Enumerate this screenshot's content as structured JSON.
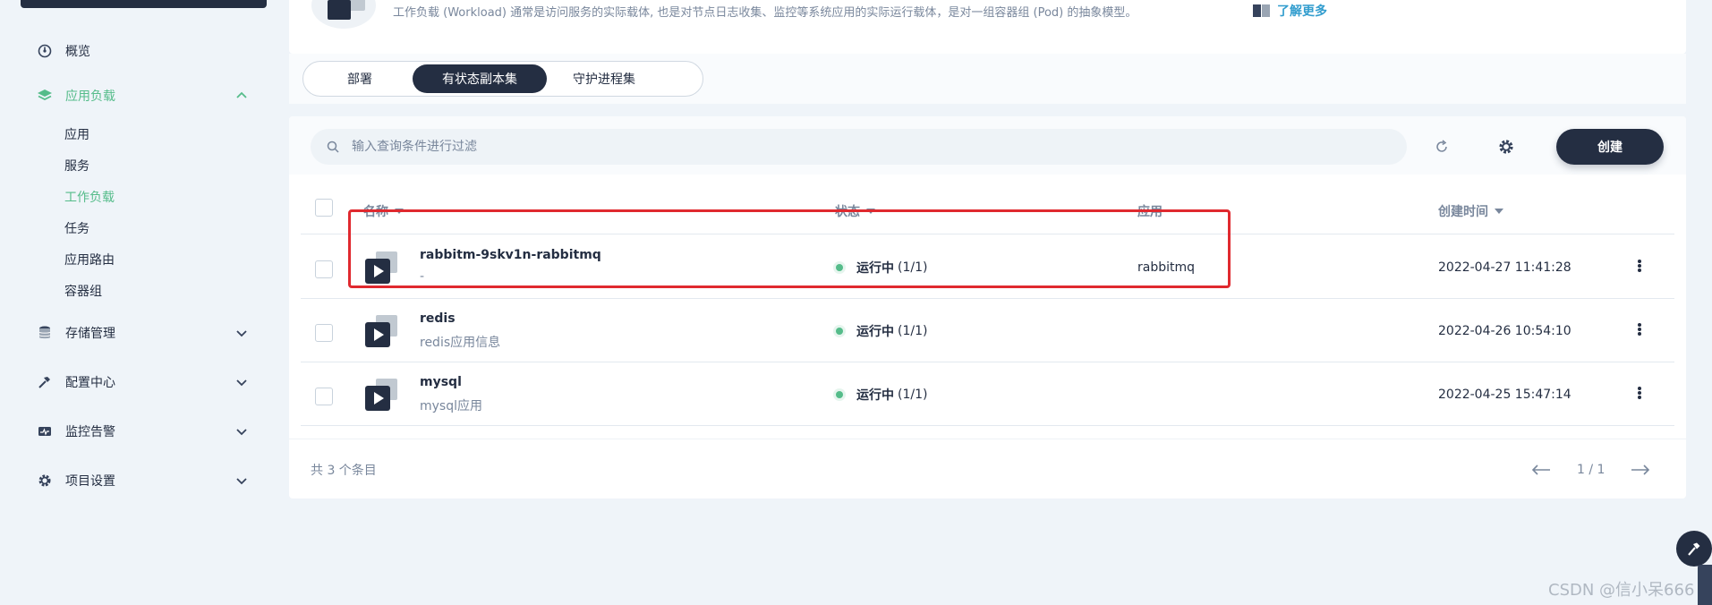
{
  "sidebar": {
    "items": [
      {
        "label": "概览",
        "icon": "dashboard-icon"
      },
      {
        "label": "应用负载",
        "icon": "layers-icon",
        "expanded": true,
        "children": [
          "应用",
          "服务",
          "工作负载",
          "任务",
          "应用路由",
          "容器组"
        ],
        "active_child": "工作负载"
      },
      {
        "label": "存储管理",
        "icon": "database-icon"
      },
      {
        "label": "配置中心",
        "icon": "hammer-icon"
      },
      {
        "label": "监控告警",
        "icon": "monitor-icon"
      },
      {
        "label": "项目设置",
        "icon": "gear-icon"
      }
    ]
  },
  "banner": {
    "description": "工作负载 (Workload) 通常是访问服务的实际载体, 也是对节点日志收集、监控等系统应用的实际运行载体，是对一组容器组 (Pod) 的抽象模型。",
    "learn_more": "了解更多"
  },
  "tabs": [
    {
      "label": "部署",
      "active": false
    },
    {
      "label": "有状态副本集",
      "active": true
    },
    {
      "label": "守护进程集",
      "active": false
    }
  ],
  "search": {
    "placeholder": "输入查询条件进行过滤"
  },
  "toolbar": {
    "create_label": "创建"
  },
  "table": {
    "columns": {
      "name": "名称",
      "status": "状态",
      "app": "应用",
      "created": "创建时间"
    },
    "rows": [
      {
        "name": "rabbitm-9skv1n-rabbitmq",
        "desc": "-",
        "status": "运行中",
        "count": "(1/1)",
        "app": "rabbitmq",
        "created": "2022-04-27 11:41:28"
      },
      {
        "name": "redis",
        "desc": "redis应用信息",
        "status": "运行中",
        "count": "(1/1)",
        "app": "",
        "created": "2022-04-26 10:54:10"
      },
      {
        "name": "mysql",
        "desc": "mysql应用",
        "status": "运行中",
        "count": "(1/1)",
        "app": "",
        "created": "2022-04-25 15:47:14"
      }
    ]
  },
  "footer": {
    "total": "共 3 个条目",
    "page": "1 / 1"
  },
  "watermark": "CSDN @信小呆666",
  "colors": {
    "accent": "#55bc8a",
    "dark": "#242e42",
    "muted": "#79879c",
    "highlight": "#e0292f"
  }
}
